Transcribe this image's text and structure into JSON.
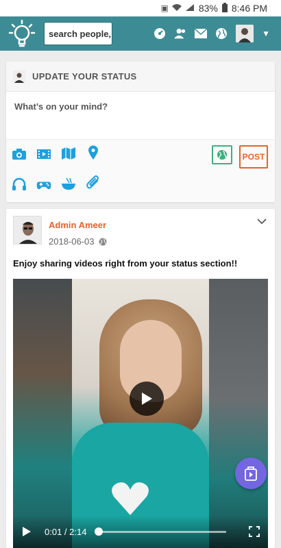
{
  "status_bar": {
    "battery": "83%",
    "time": "8:46 PM"
  },
  "header": {
    "search_placeholder": "search people,",
    "icons": [
      "lightbulb-logo",
      "dashboard-icon",
      "friends-icon",
      "mail-icon",
      "globe-icon",
      "avatar",
      "chevron-down-icon"
    ]
  },
  "status_card": {
    "title": "UPDATE YOUR STATUS",
    "prompt": "What’s on your mind?",
    "post_label": "POST",
    "tools": [
      "camera-icon",
      "video-icon",
      "map-icon",
      "location-pin-icon",
      "headphones-icon",
      "game-controller-icon",
      "food-bowl-icon",
      "attachment-icon"
    ]
  },
  "post": {
    "author": "Admin Ameer",
    "date": "2018-06-03",
    "text": "Enjoy sharing videos right from your status section!!",
    "video": {
      "current": "0:01",
      "duration": "2:14",
      "time_display": "0:01 / 2:14",
      "progress": 0.0075
    }
  },
  "colors": {
    "header_bg": "#3d8c95",
    "accent_orange": "#e4632b",
    "accent_green": "#3bb07f",
    "icon_blue": "#1ea0de",
    "fab_purple": "#7466e0"
  }
}
